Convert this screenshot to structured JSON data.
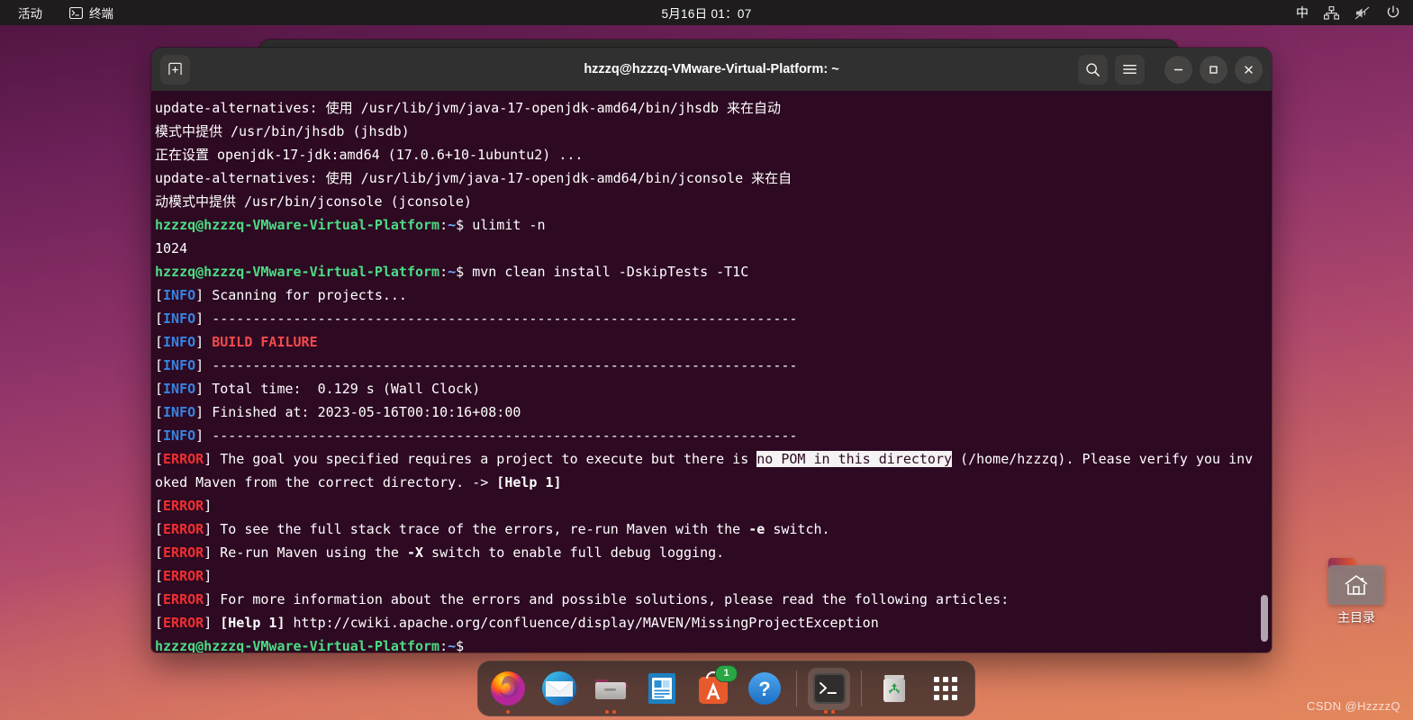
{
  "topbar": {
    "activities": "活动",
    "app_name": "终端",
    "app_icon": "terminal-icon",
    "clock": "5月16日 01：07",
    "ime": "中",
    "indicators": [
      "network-icon",
      "volume-muted-icon",
      "power-icon"
    ]
  },
  "desktop": {
    "home_icon_label": "主目录",
    "watermark": "CSDN @HzzzzQ",
    "wallpaper_accent": "#b0496c"
  },
  "window": {
    "title": "hzzzq@hzzzq-VMware-Virtual-Platform: ~",
    "buttons": {
      "new_tab": "new-terminal-icon",
      "search": "search-icon",
      "menu": "hamburger-menu-icon",
      "minimize": "minimize-icon",
      "maximize": "maximize-icon",
      "close": "close-icon"
    },
    "background_color": "#2d0922"
  },
  "terminal": {
    "prompt": "hzzzq@hzzzq-VMware-Virtual-Platform",
    "prompt_path": ":~$",
    "selection_text": "no POM in this directory",
    "lines": [
      {
        "id": "l1",
        "segments": [
          {
            "t": "update-alternatives: 使用 /usr/lib/jvm/java-17-openjdk-amd64/bin/jhsdb 来在自动",
            "c": "c-white"
          }
        ]
      },
      {
        "id": "l2",
        "segments": [
          {
            "t": "模式中提供 /usr/bin/jhsdb (jhsdb)",
            "c": "c-white"
          }
        ]
      },
      {
        "id": "l3",
        "segments": [
          {
            "t": "正在设置 openjdk-17-jdk:amd64 (17.0.6+10-1ubuntu2) ...",
            "c": "c-white"
          }
        ]
      },
      {
        "id": "l4",
        "segments": [
          {
            "t": "update-alternatives: 使用 /usr/lib/jvm/java-17-openjdk-amd64/bin/jconsole 来在自",
            "c": "c-white"
          }
        ]
      },
      {
        "id": "l5",
        "segments": [
          {
            "t": "动模式中提供 /usr/bin/jconsole (jconsole)",
            "c": "c-white"
          }
        ]
      },
      {
        "id": "l6",
        "segments": [
          {
            "t": "hzzzq@hzzzq-VMware-Virtual-Platform",
            "c": "c-prompt"
          },
          {
            "t": ":",
            "c": "c-white"
          },
          {
            "t": "~",
            "c": "c-path"
          },
          {
            "t": "$ ulimit -n",
            "c": "c-white"
          }
        ]
      },
      {
        "id": "l7",
        "segments": [
          {
            "t": "1024",
            "c": "c-white"
          }
        ]
      },
      {
        "id": "l8",
        "segments": [
          {
            "t": "hzzzq@hzzzq-VMware-Virtual-Platform",
            "c": "c-prompt"
          },
          {
            "t": ":",
            "c": "c-white"
          },
          {
            "t": "~",
            "c": "c-path"
          },
          {
            "t": "$ mvn clean install -DskipTests -T1C",
            "c": "c-white"
          }
        ]
      },
      {
        "id": "l9",
        "segments": [
          {
            "t": "[",
            "c": "c-white"
          },
          {
            "t": "INFO",
            "c": "c-info"
          },
          {
            "t": "] Scanning for projects...",
            "c": "c-white"
          }
        ]
      },
      {
        "id": "l10",
        "segments": [
          {
            "t": "[",
            "c": "c-white"
          },
          {
            "t": "INFO",
            "c": "c-info"
          },
          {
            "t": "] ------------------------------------------------------------------------",
            "c": "c-white"
          }
        ]
      },
      {
        "id": "l11",
        "segments": [
          {
            "t": "[",
            "c": "c-white"
          },
          {
            "t": "INFO",
            "c": "c-info"
          },
          {
            "t": "] ",
            "c": "c-white"
          },
          {
            "t": "BUILD FAILURE",
            "c": "c-red"
          }
        ]
      },
      {
        "id": "l12",
        "segments": [
          {
            "t": "[",
            "c": "c-white"
          },
          {
            "t": "INFO",
            "c": "c-info"
          },
          {
            "t": "] ------------------------------------------------------------------------",
            "c": "c-white"
          }
        ]
      },
      {
        "id": "l13",
        "segments": [
          {
            "t": "[",
            "c": "c-white"
          },
          {
            "t": "INFO",
            "c": "c-info"
          },
          {
            "t": "] Total time:  0.129 s (Wall Clock)",
            "c": "c-white"
          }
        ]
      },
      {
        "id": "l14",
        "segments": [
          {
            "t": "[",
            "c": "c-white"
          },
          {
            "t": "INFO",
            "c": "c-info"
          },
          {
            "t": "] Finished at: 2023-05-16T00:10:16+08:00",
            "c": "c-white"
          }
        ]
      },
      {
        "id": "l15",
        "segments": [
          {
            "t": "[",
            "c": "c-white"
          },
          {
            "t": "INFO",
            "c": "c-info"
          },
          {
            "t": "] ------------------------------------------------------------------------",
            "c": "c-white"
          }
        ]
      },
      {
        "id": "l16",
        "segments": [
          {
            "t": "[",
            "c": "c-white"
          },
          {
            "t": "ERROR",
            "c": "c-error"
          },
          {
            "t": "] The goal you specified requires a project to execute but there is ",
            "c": "c-white"
          },
          {
            "t": "no POM in this directory",
            "c": "c-sel"
          },
          {
            "t": " (/home/hzzzq). Please verify you invoked Maven from the correct directory. -> ",
            "c": "c-white"
          },
          {
            "t": "[Help 1]",
            "c": "c-bold"
          }
        ]
      },
      {
        "id": "l17",
        "segments": [
          {
            "t": "[",
            "c": "c-white"
          },
          {
            "t": "ERROR",
            "c": "c-error"
          },
          {
            "t": "] ",
            "c": "c-white"
          }
        ]
      },
      {
        "id": "l18",
        "segments": [
          {
            "t": "[",
            "c": "c-white"
          },
          {
            "t": "ERROR",
            "c": "c-error"
          },
          {
            "t": "] To see the full stack trace of the errors, re-run Maven with the ",
            "c": "c-white"
          },
          {
            "t": "-e",
            "c": "c-bold"
          },
          {
            "t": " switch.",
            "c": "c-white"
          }
        ]
      },
      {
        "id": "l19",
        "segments": [
          {
            "t": "[",
            "c": "c-white"
          },
          {
            "t": "ERROR",
            "c": "c-error"
          },
          {
            "t": "] Re-run Maven using the ",
            "c": "c-white"
          },
          {
            "t": "-X",
            "c": "c-bold"
          },
          {
            "t": " switch to enable full debug logging.",
            "c": "c-white"
          }
        ]
      },
      {
        "id": "l20",
        "segments": [
          {
            "t": "[",
            "c": "c-white"
          },
          {
            "t": "ERROR",
            "c": "c-error"
          },
          {
            "t": "] ",
            "c": "c-white"
          }
        ]
      },
      {
        "id": "l21",
        "segments": [
          {
            "t": "[",
            "c": "c-white"
          },
          {
            "t": "ERROR",
            "c": "c-error"
          },
          {
            "t": "] For more information about the errors and possible solutions, please read the following articles:",
            "c": "c-white"
          }
        ]
      },
      {
        "id": "l22",
        "segments": [
          {
            "t": "[",
            "c": "c-white"
          },
          {
            "t": "ERROR",
            "c": "c-error"
          },
          {
            "t": "] ",
            "c": "c-white"
          },
          {
            "t": "[Help 1]",
            "c": "c-bold"
          },
          {
            "t": " http://cwiki.apache.org/confluence/display/MAVEN/MissingProjectException",
            "c": "c-white"
          }
        ]
      },
      {
        "id": "l23",
        "segments": [
          {
            "t": "hzzzq@hzzzq-VMware-Virtual-Platform",
            "c": "c-prompt"
          },
          {
            "t": ":",
            "c": "c-white"
          },
          {
            "t": "~",
            "c": "c-path"
          },
          {
            "t": "$ ",
            "c": "c-white"
          }
        ]
      }
    ]
  },
  "dock": {
    "items": [
      {
        "name": "firefox",
        "icon": "firefox-icon",
        "dots": 1,
        "badge": "",
        "active": false
      },
      {
        "name": "thunderbird",
        "icon": "thunderbird-icon",
        "dots": 0,
        "badge": "",
        "active": false
      },
      {
        "name": "files",
        "icon": "files-icon",
        "dots": 2,
        "badge": "",
        "active": false
      },
      {
        "name": "libreoffice-writer",
        "icon": "libreoffice-writer-icon",
        "dots": 0,
        "badge": "",
        "active": false
      },
      {
        "name": "ubuntu-software",
        "icon": "ubuntu-software-icon",
        "dots": 0,
        "badge": "1",
        "active": false
      },
      {
        "name": "help",
        "icon": "help-icon",
        "dots": 0,
        "badge": "",
        "active": false
      },
      {
        "name": "terminal",
        "icon": "terminal-icon",
        "dots": 2,
        "badge": "",
        "active": true
      },
      {
        "name": "trash",
        "icon": "trash-icon",
        "dots": 0,
        "badge": "",
        "active": false
      },
      {
        "name": "show-apps",
        "icon": "app-grid-icon",
        "dots": 0,
        "badge": "",
        "active": false
      }
    ]
  }
}
